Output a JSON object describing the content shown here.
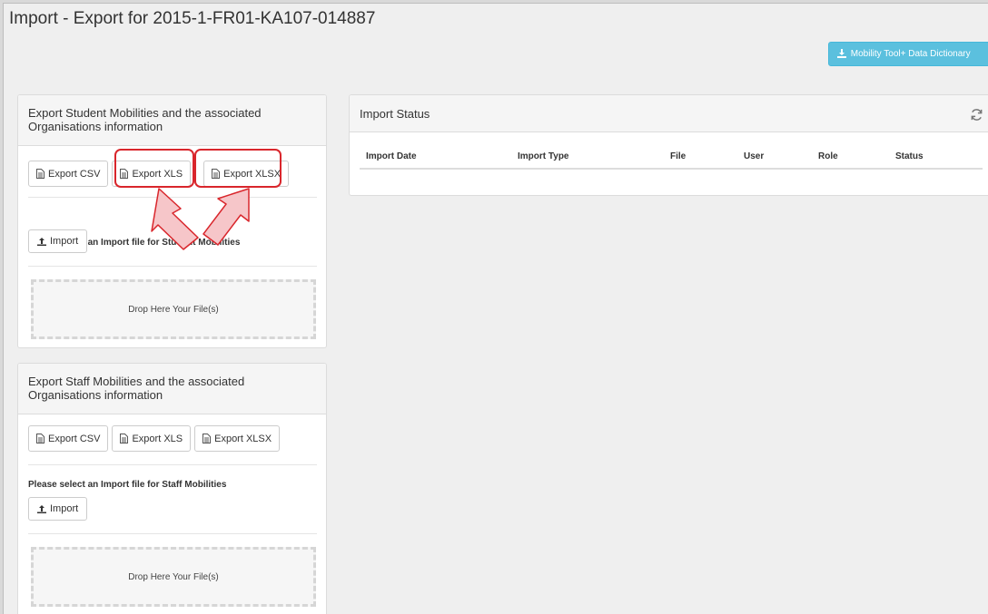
{
  "page": {
    "title": "Import - Export for 2015-1-FR01-KA107-014887",
    "dictionary_button": "Mobility Tool+ Data Dictionary"
  },
  "student_panel": {
    "heading": "Export Student Mobilities and the associated Organisations information",
    "export_buttons": [
      {
        "label": "Export CSV",
        "icon": "file-icon"
      },
      {
        "label": "Export XLS",
        "icon": "file-icon"
      },
      {
        "label": "Export XLSX",
        "icon": "file-icon"
      }
    ],
    "import_label": "Please select an Import file for Student Mobilities",
    "import_button": "Import",
    "dropzone_text": "Drop Here Your File(s)"
  },
  "staff_panel": {
    "heading": "Export Staff Mobilities and the associated Organisations information",
    "export_buttons": [
      {
        "label": "Export CSV",
        "icon": "file-icon"
      },
      {
        "label": "Export XLS",
        "icon": "file-icon"
      },
      {
        "label": "Export XLSX",
        "icon": "file-icon"
      }
    ],
    "import_label": "Please select an Import file for Staff Mobilities",
    "import_button": "Import",
    "dropzone_text": "Drop Here Your File(s)"
  },
  "status_panel": {
    "heading": "Import Status",
    "columns": [
      "Import Date",
      "Import Type",
      "File",
      "User",
      "Role",
      "Status"
    ]
  },
  "colors": {
    "accent": "#5bc0de",
    "annotation": "#d9262c",
    "arrow_fill": "#f6c6c9"
  }
}
